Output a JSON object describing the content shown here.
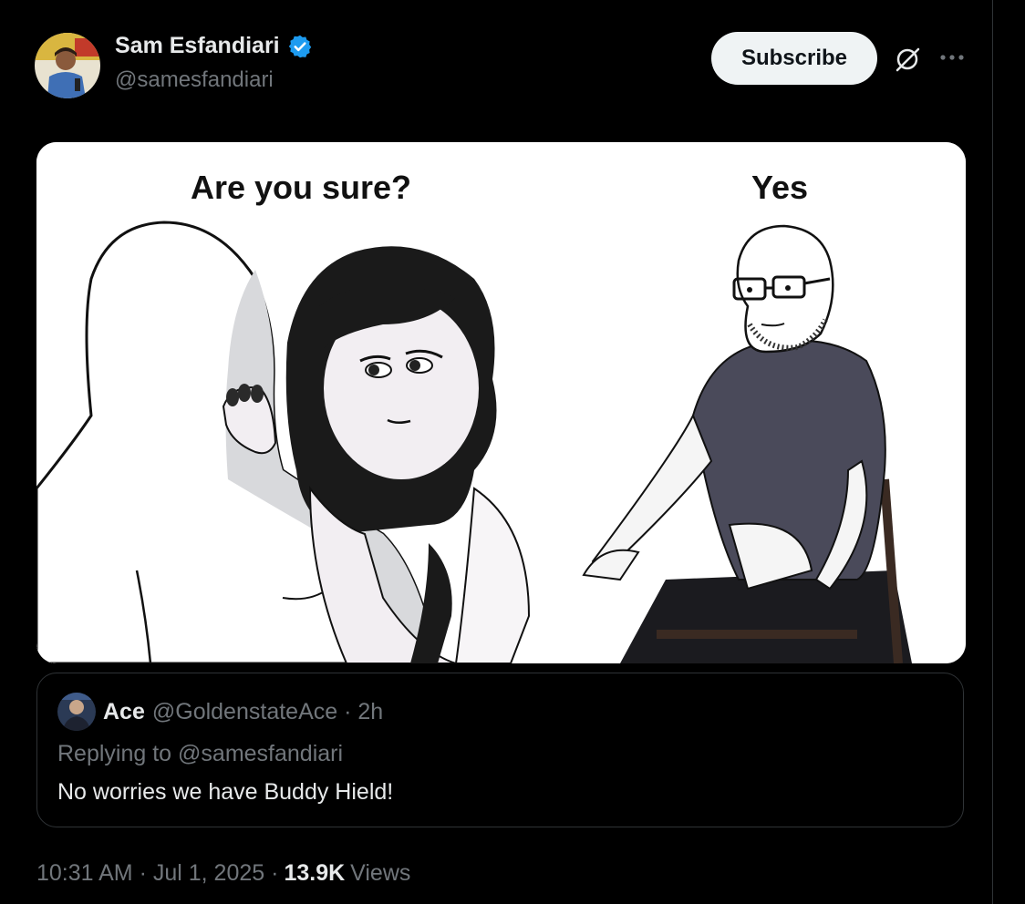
{
  "author": {
    "display_name": "Sam Esfandiari",
    "handle": "@samesfandiari",
    "verified_color": "#1d9bf0"
  },
  "actions": {
    "subscribe_label": "Subscribe",
    "grok_icon": "grok-icon",
    "more_icon": "more-icon"
  },
  "media": {
    "left_caption": "Are you sure?",
    "right_caption": "Yes"
  },
  "quote": {
    "name": "Ace",
    "handle_time": "@GoldenstateAce · 2h",
    "reply_prefix": "Replying to",
    "reply_mention": "@samesfandiari",
    "text": "No worries we have Buddy Hield!"
  },
  "footer": {
    "time_date": "10:31 AM · Jul 1, 2025 ·",
    "views_count": "13.9K",
    "views_label": "Views"
  }
}
